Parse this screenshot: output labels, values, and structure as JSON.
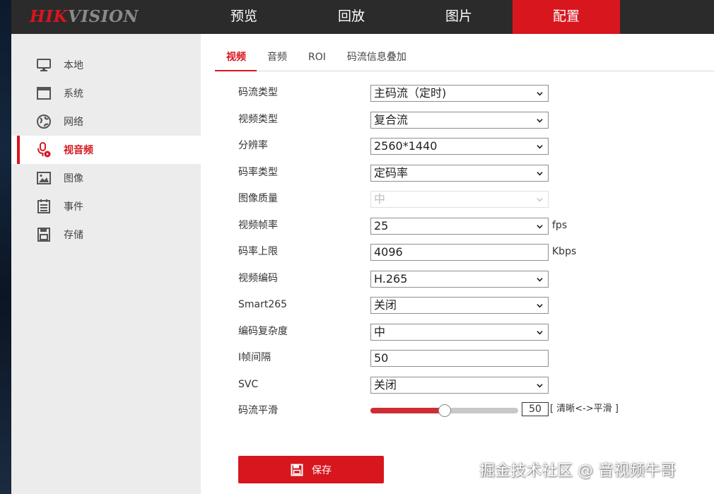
{
  "brand": {
    "logo_red": "HIK",
    "logo_gray": "VISION",
    "accent": "#d7161e"
  },
  "nav": {
    "items": [
      {
        "label": "预览"
      },
      {
        "label": "回放"
      },
      {
        "label": "图片"
      },
      {
        "label": "配置"
      }
    ],
    "active": "配置"
  },
  "sidebar": {
    "items": [
      {
        "label": "本地",
        "icon": "monitor-icon"
      },
      {
        "label": "系统",
        "icon": "system-window-icon"
      },
      {
        "label": "网络",
        "icon": "globe-icon"
      },
      {
        "label": "视音频",
        "icon": "mic-icon"
      },
      {
        "label": "图像",
        "icon": "image-icon"
      },
      {
        "label": "事件",
        "icon": "event-list-icon"
      },
      {
        "label": "存储",
        "icon": "save-disk-icon"
      }
    ],
    "active": "视音频"
  },
  "tabs": {
    "items": [
      {
        "label": "视频"
      },
      {
        "label": "音频"
      },
      {
        "label": "ROI"
      },
      {
        "label": "码流信息叠加"
      }
    ],
    "active": "视频"
  },
  "form": {
    "stream_type": {
      "label": "码流类型",
      "value": "主码流（定时)"
    },
    "video_type": {
      "label": "视频类型",
      "value": "复合流"
    },
    "resolution": {
      "label": "分辨率",
      "value": "2560*1440"
    },
    "bitrate_type": {
      "label": "码率类型",
      "value": "定码率"
    },
    "image_quality": {
      "label": "图像质量",
      "value": "中"
    },
    "frame_rate": {
      "label": "视频帧率",
      "value": "25",
      "unit": "fps"
    },
    "max_bitrate": {
      "label": "码率上限",
      "value": "4096",
      "unit": "Kbps"
    },
    "encoding": {
      "label": "视频编码",
      "value": "H.265"
    },
    "smart265": {
      "label": "Smart265",
      "value": "关闭"
    },
    "complexity": {
      "label": "编码复杂度",
      "value": "中"
    },
    "i_frame_interval": {
      "label": "I帧间隔",
      "value": "50"
    },
    "svc": {
      "label": "SVC",
      "value": "关闭"
    },
    "smoothing": {
      "label": "码流平滑",
      "value": "50",
      "level": 0.5,
      "hint": "[ 清晰<->平滑 ]"
    }
  },
  "save_button": {
    "label": "保存"
  },
  "watermark": "掘金技术社区 @ 音视频牛哥"
}
